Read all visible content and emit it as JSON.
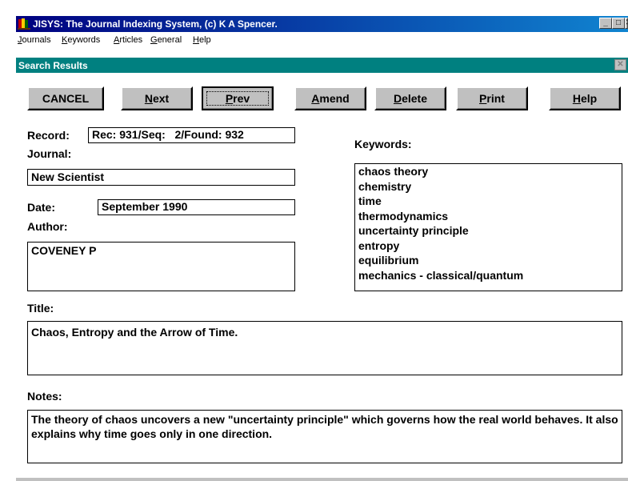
{
  "window": {
    "title": "JISYS: The Journal Indexing System, (c) K A Spencer.",
    "minimize_glyph": "_",
    "maximize_glyph": "□",
    "close_glyph": "✕"
  },
  "menubar": {
    "items": [
      {
        "label": "Journals",
        "mnemonic": "J"
      },
      {
        "label": "Keywords",
        "mnemonic": "K"
      },
      {
        "label": "Articles",
        "mnemonic": "A"
      },
      {
        "label": "General",
        "mnemonic": "G"
      },
      {
        "label": "Help",
        "mnemonic": "H"
      }
    ]
  },
  "dialog": {
    "title": "Search Results",
    "close_glyph": "✕"
  },
  "buttons": {
    "cancel": "CANCEL",
    "next": "Next",
    "prev": "Prev",
    "amend": "Amend",
    "delete": "Delete",
    "print": "Print",
    "help": "Help"
  },
  "record": {
    "label": "Record:",
    "value": "Rec: 931/Seq:   2/Found: 932"
  },
  "journal": {
    "label": "Journal:",
    "value": "New Scientist"
  },
  "date": {
    "label": "Date:",
    "value": "September 1990"
  },
  "author": {
    "label": "Author:",
    "value": "COVENEY P"
  },
  "keywords": {
    "label": "Keywords:",
    "items": [
      "chaos theory",
      "chemistry",
      "time",
      "thermodynamics",
      "uncertainty principle",
      "entropy",
      "equilibrium",
      "mechanics - classical/quantum"
    ]
  },
  "title": {
    "label": "Title:",
    "value": "Chaos, Entropy and the Arrow of Time."
  },
  "notes": {
    "label": "Notes:",
    "value": "The theory of chaos uncovers a new \"uncertainty principle\" which governs how the real world behaves. It also explains why time goes only in one direction."
  },
  "colors": {
    "titlebar": "#000080",
    "dialog_titlebar": "#008080",
    "button_face": "#c0c0c0"
  }
}
